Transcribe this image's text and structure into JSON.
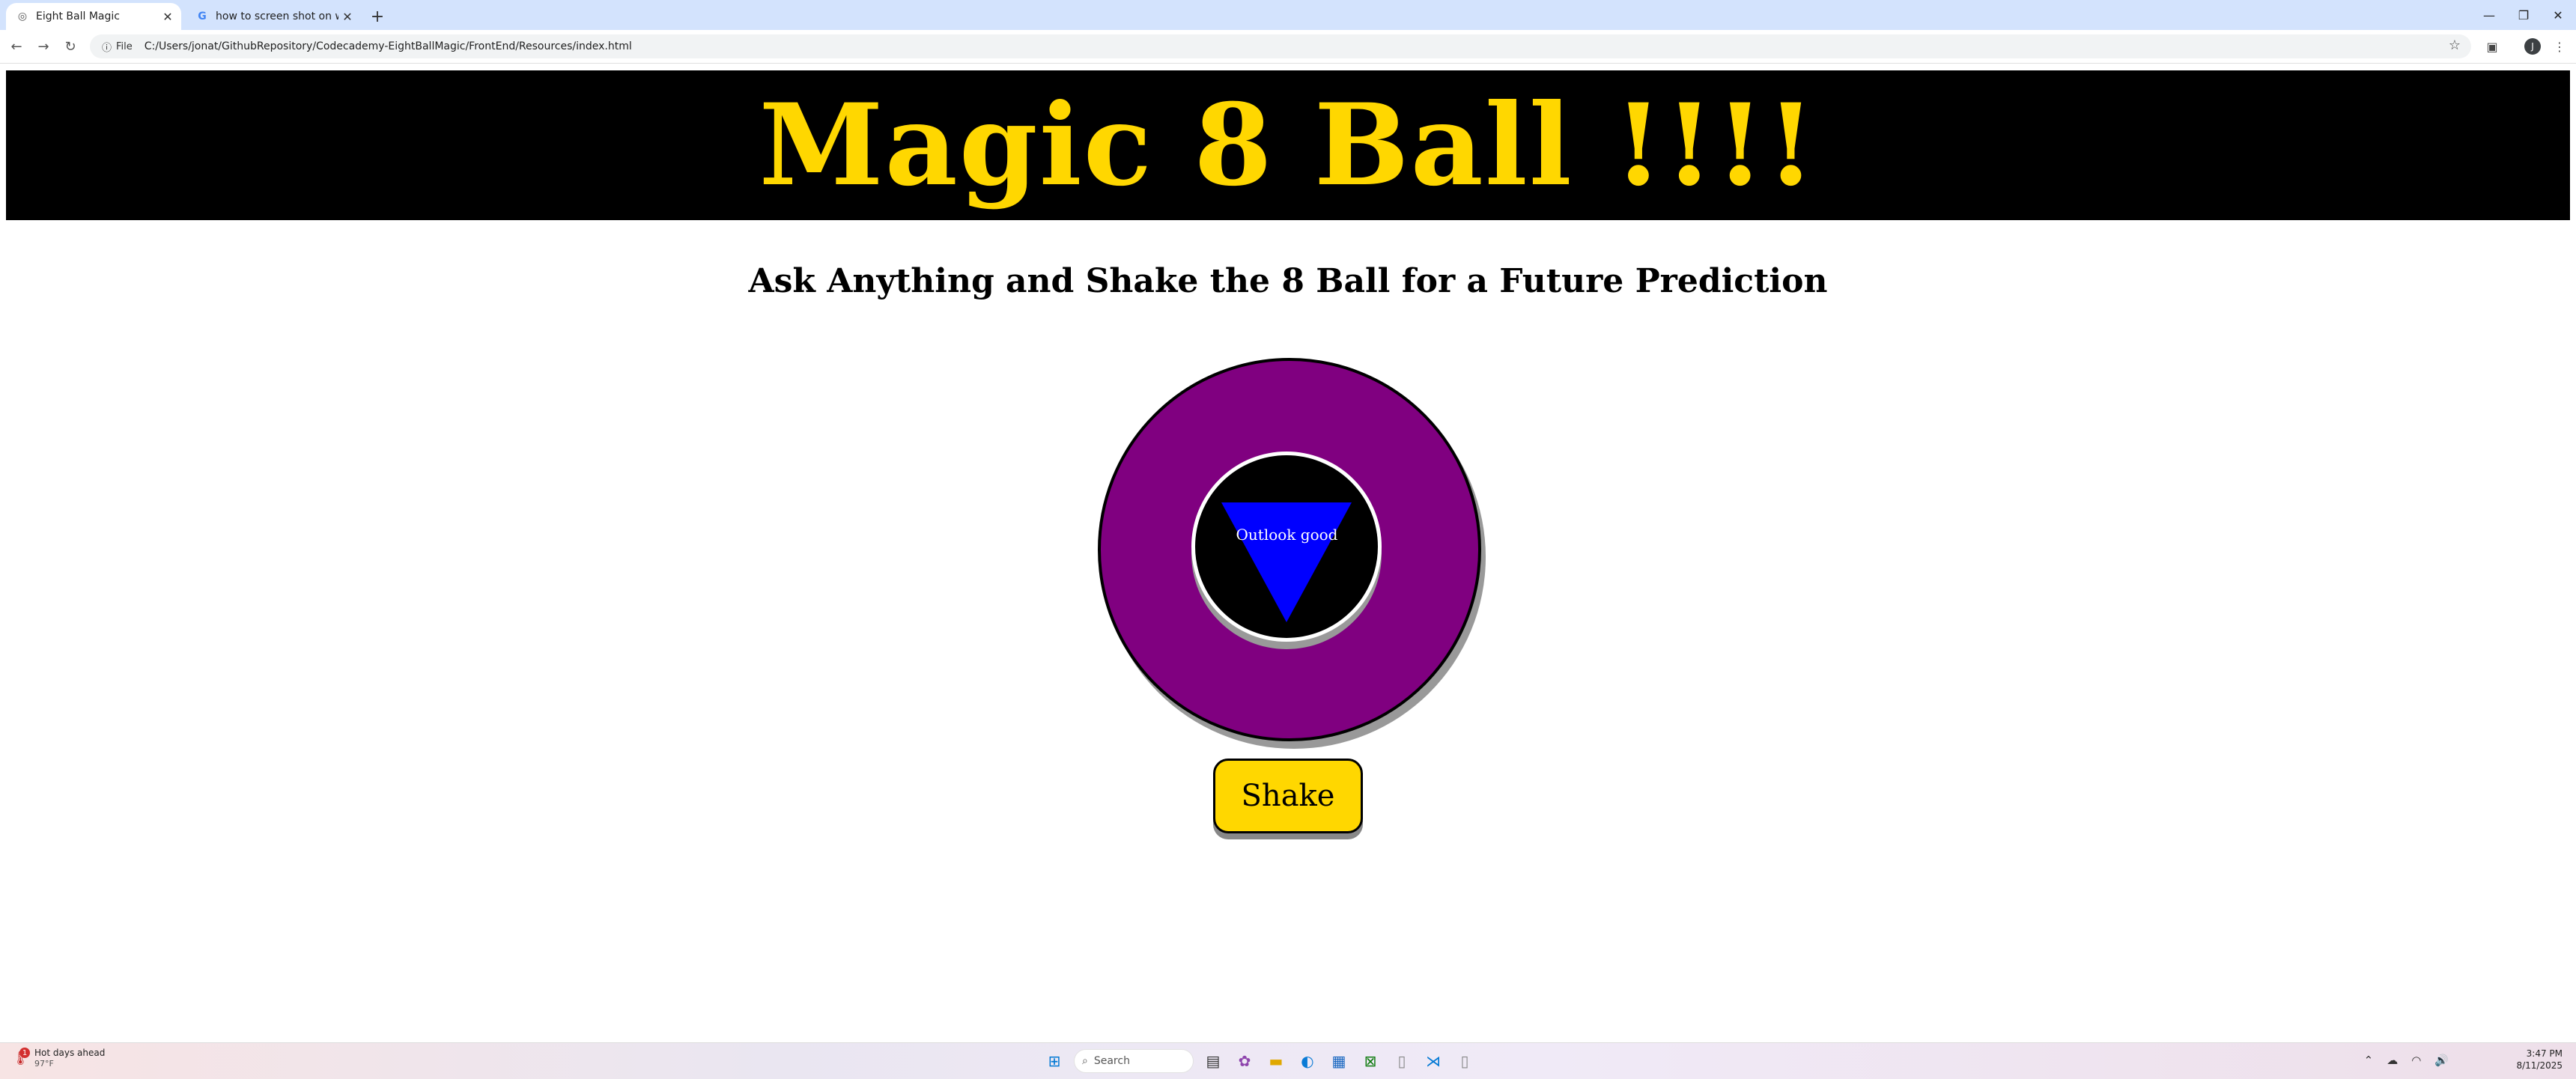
{
  "browser": {
    "tabs": [
      {
        "title": "Eight Ball Magic",
        "active": true
      },
      {
        "title": "how to screen shot on windows",
        "active": false
      }
    ],
    "new_tab": "+",
    "address": {
      "scheme_chip": "File",
      "url": "C:/Users/jonat/GithubRepository/Codecademy-EightBallMagic/FrontEnd/Resources/index.html"
    },
    "profile_initial": "J"
  },
  "page": {
    "banner_title": "Magic 8 Ball !!!!",
    "subtitle": "Ask Anything and Shake the 8 Ball for a Future Prediction",
    "answer": "Outlook good",
    "shake_label": "Shake",
    "colors": {
      "banner_bg": "#000000",
      "title_gold": "#ffd700",
      "ball_purple": "#800080",
      "triangle_blue": "#0000ff",
      "button_gold": "#ffd700"
    }
  },
  "taskbar": {
    "weather_title": "Hot days ahead",
    "weather_temp": "97°F",
    "weather_badge": "1",
    "search_placeholder": "Search",
    "time": "3:47 PM",
    "date": "8/11/2025"
  }
}
